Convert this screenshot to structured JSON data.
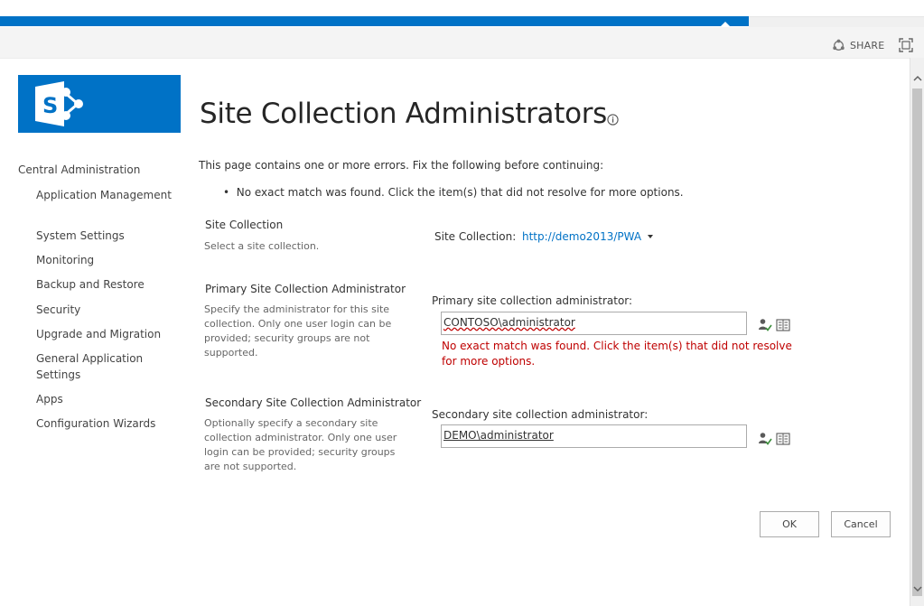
{
  "suite_bar": {
    "share_label": "SHARE",
    "share_icon": "share-icon",
    "focus_icon": "focus-on-content-icon"
  },
  "logo": {
    "icon": "sharepoint-logo-icon",
    "letter": "S"
  },
  "page": {
    "title": "Site Collection Administrators",
    "title_icon": "info-icon"
  },
  "quicklaunch": {
    "root": "Central Administration",
    "items": [
      "Application Management",
      "System Settings",
      "Monitoring",
      "Backup and Restore",
      "Security",
      "Upgrade and Migration",
      "General Application Settings",
      "Apps",
      "Configuration Wizards"
    ]
  },
  "errors": {
    "summary": "This page contains one or more errors. Fix the following before continuing:",
    "bullet": "No exact match was found. Click the item(s) that did not resolve for more options."
  },
  "site_collection": {
    "title": "Site Collection",
    "description": "Select a site collection.",
    "field_label": "Site Collection:",
    "value": "http://demo2013/PWA"
  },
  "primary_admin": {
    "title": "Primary Site Collection Administrator",
    "description": "Specify the administrator for this site collection. Only one user login can be provided; security groups are not supported.",
    "field_label": "Primary site collection administrator:",
    "value": "CONTOSO\\administrator",
    "error": "No exact match was found. Click the item(s) that did not resolve for more options.",
    "check_names_icon": "check-names-icon",
    "browse_icon": "address-book-icon"
  },
  "secondary_admin": {
    "title": "Secondary Site Collection Administrator",
    "description": "Optionally specify a secondary site collection administrator. Only one user login can be provided; security groups are not supported.",
    "field_label": "Secondary site collection administrator:",
    "value": "DEMO\\administrator",
    "check_names_icon": "check-names-icon",
    "browse_icon": "address-book-icon"
  },
  "buttons": {
    "ok": "OK",
    "cancel": "Cancel"
  },
  "colors": {
    "brand_blue": "#0072c6",
    "error_red": "#bf0000",
    "link_blue": "#0072c6"
  }
}
